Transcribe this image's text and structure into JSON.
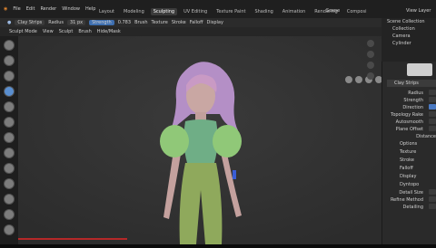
{
  "menu": [
    "File",
    "Edit",
    "Render",
    "Window",
    "Help"
  ],
  "tabs": [
    "Layout",
    "Modeling",
    "Sculpting",
    "UV Editing",
    "Texture Paint",
    "Shading",
    "Animation",
    "Rendering",
    "Composi"
  ],
  "active_tab_index": 2,
  "scene": "Scene",
  "view_layer": "View Layer",
  "tool_header": {
    "brush_name": "Clay Strips",
    "radius_label": "Radius",
    "radius_value": "31 px",
    "strength_label": "Strength",
    "strength_value": "0.783",
    "brush_label": "Brush",
    "texture_label": "Texture",
    "stroke_label": "Stroke",
    "falloff_label": "Falloff",
    "display_label": "Display"
  },
  "header2": {
    "mode": "Sculpt Mode",
    "items": [
      "View",
      "Sculpt",
      "Brush",
      "Hide/Mask"
    ]
  },
  "outliner": {
    "items": [
      "Scene Collection",
      "Collection",
      "Camera",
      "Cylinder"
    ]
  },
  "properties": {
    "brush_name": "Clay Strips",
    "fields": [
      {
        "label": "Radius"
      },
      {
        "label": "Strength"
      },
      {
        "label": "Direction"
      },
      {
        "label": "Topology Rake"
      },
      {
        "label": "Autosmooth"
      },
      {
        "label": "Plane Offset"
      }
    ],
    "distance_label": "Distance",
    "sections": [
      "Options",
      "Texture",
      "Stroke",
      "Falloff",
      "Display",
      "Dyntopo"
    ],
    "dyntopo": [
      "Detail Size",
      "Refine Method",
      "Detailing"
    ]
  },
  "colors": {
    "viewport_bg": "#333333",
    "hair_purple": "#b88ac8",
    "hair_pink": "#c89ac0",
    "skin": "#c9a7a3",
    "shirt_green": "#7fbf7f",
    "pants_green": "#8aa85a",
    "accent_blue": "#3e6fb0"
  }
}
